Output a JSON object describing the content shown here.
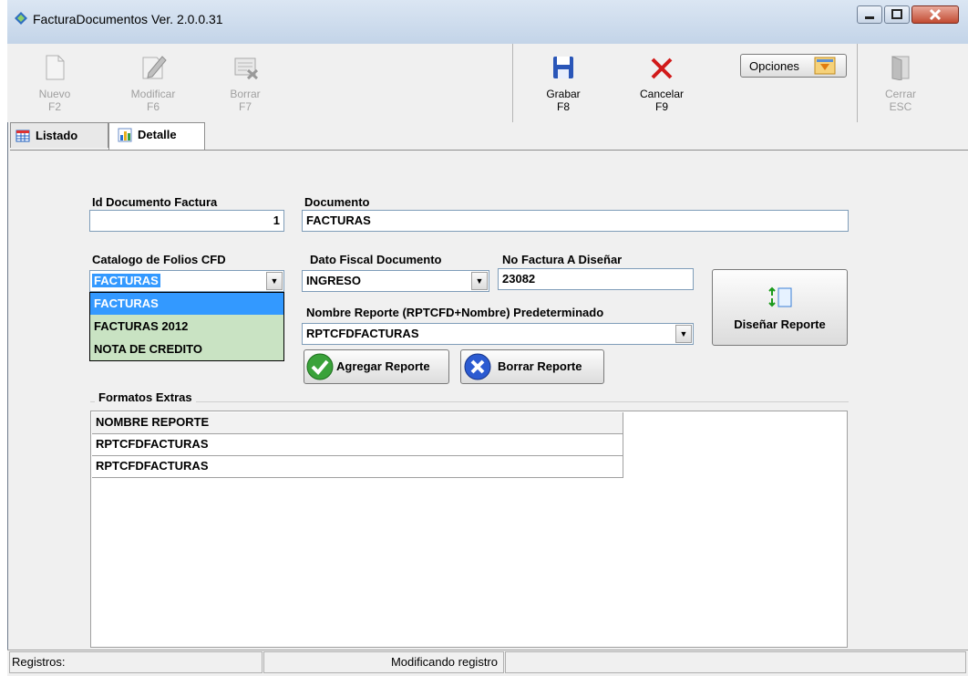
{
  "window": {
    "title": "FacturaDocumentos Ver. 2.0.0.31"
  },
  "toolbar": {
    "nuevo": {
      "label": "Nuevo",
      "key": "F2",
      "icon": "new-document-icon"
    },
    "modificar": {
      "label": "Modificar",
      "key": "F6",
      "icon": "edit-pencil-icon"
    },
    "borrar": {
      "label": "Borrar",
      "key": "F7",
      "icon": "delete-document-icon"
    },
    "grabar": {
      "label": "Grabar",
      "key": "F8",
      "icon": "save-floppy-icon"
    },
    "cancelar": {
      "label": "Cancelar",
      "key": "F9",
      "icon": "cancel-x-icon"
    },
    "opciones": {
      "label": "Opciones",
      "icon": "dropdown-arrow-icon"
    },
    "cerrar": {
      "label": "Cerrar",
      "key": "ESC",
      "icon": "exit-door-icon"
    }
  },
  "tabs": [
    {
      "label": "Listado",
      "icon": "table-grid-icon"
    },
    {
      "label": "Detalle",
      "icon": "chart-detail-icon"
    }
  ],
  "form": {
    "id_label": "Id Documento Factura",
    "id_value": "1",
    "documento_label": "Documento",
    "documento_value": "FACTURAS",
    "catalogo_label": "Catalogo de Folios CFD",
    "catalogo_value": "FACTURAS",
    "catalogo_options": [
      "FACTURAS",
      "FACTURAS 2012",
      "NOTA DE CREDITO"
    ],
    "dato_fiscal_label": "Dato Fiscal Documento",
    "dato_fiscal_value": "INGRESO",
    "no_factura_label": "No Factura A Diseñar",
    "no_factura_value": "23082",
    "nombre_reporte_label": "Nombre Reporte (RPTCFD+Nombre) Predeterminado",
    "nombre_reporte_value": "RPTCFDFACTURAS",
    "disenar_label": "Diseñar Reporte",
    "agregar_label": "Agregar Reporte",
    "borrar_reporte_label": "Borrar Reporte"
  },
  "formatos": {
    "group_label": "Formatos Extras",
    "header": "NOMBRE REPORTE",
    "rows": [
      "RPTCFDFACTURAS",
      "RPTCFDFACTURAS"
    ]
  },
  "status": {
    "registros": "Registros:",
    "estado": "Modificando registro"
  },
  "colors": {
    "titlebar": "#c3d4e8",
    "selection": "#3399ff",
    "dropdown_bg": "#c9e3c3",
    "accent_green": "#2e9b2e",
    "accent_blue": "#1f4fc2",
    "cancel_red": "#d11a1a"
  }
}
